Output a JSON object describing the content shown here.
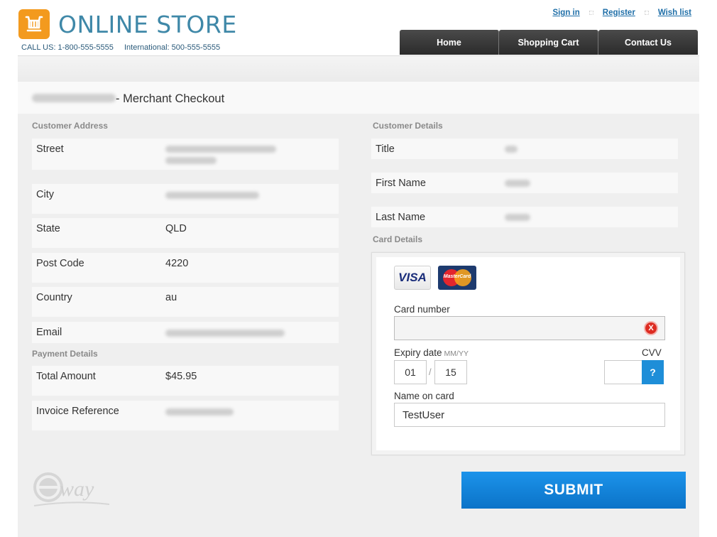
{
  "brand": {
    "name": "ONLINE STORE",
    "call_us": "CALL US: 1-800-555-5555",
    "international": "International: 500-555-5555",
    "logo_color": "#f39a1e",
    "brand_color": "#3f88a8"
  },
  "top_links": [
    "Sign in",
    "Register",
    "Wish list"
  ],
  "nav": [
    "Home",
    "Shopping Cart",
    "Contact Us"
  ],
  "checkout": {
    "title_suffix": "- Merchant Checkout"
  },
  "customer_address": {
    "heading": "Customer Address",
    "fields": [
      {
        "label": "Street",
        "value": ""
      },
      {
        "label": "City",
        "value": ""
      },
      {
        "label": "State",
        "value": "QLD"
      },
      {
        "label": "Post Code",
        "value": "4220"
      },
      {
        "label": "Country",
        "value": "au"
      },
      {
        "label": "Email",
        "value": ""
      }
    ]
  },
  "payment_details": {
    "heading": "Payment Details",
    "fields": [
      {
        "label": "Total Amount",
        "value": "$45.95"
      },
      {
        "label": "Invoice Reference",
        "value": ""
      }
    ]
  },
  "customer_details": {
    "heading": "Customer Details",
    "fields": [
      {
        "label": "Title",
        "value": ""
      },
      {
        "label": "First Name",
        "value": ""
      },
      {
        "label": "Last Name",
        "value": ""
      }
    ]
  },
  "card_details": {
    "heading": "Card Details",
    "visa_label": "VISA",
    "mastercard_label": "MasterCard",
    "card_number_label": "Card number",
    "card_number_value": "",
    "clear_icon": "X",
    "expiry_label": "Expiry date",
    "expiry_hint": "MM/YY",
    "expiry_month": "01",
    "expiry_separator": "/",
    "expiry_year": "15",
    "cvv_label": "CVV",
    "cvv_value": "",
    "cvv_help": "?",
    "name_label": "Name on card",
    "name_value": "TestUser"
  },
  "submit_label": "SUBMIT",
  "footer_logo": "eway",
  "colors": {
    "nav_bg": "#2b2b2b",
    "submit_bg": "#0b73c8",
    "error_red": "#dd2b21",
    "help_blue": "#1e8ed8"
  }
}
